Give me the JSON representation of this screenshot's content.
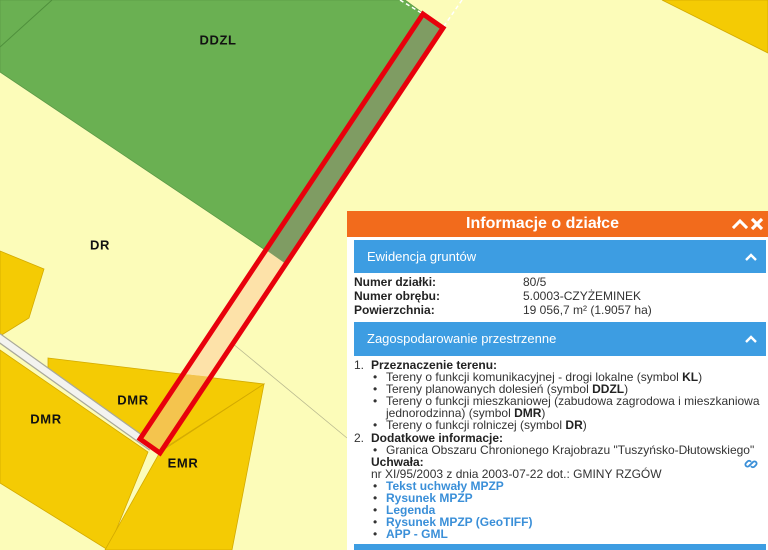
{
  "colors": {
    "header_bg": "#f26b1c",
    "section_bg": "#3d9de2",
    "link": "#3a8fd8",
    "parcel_outline": "#e8000b",
    "zone_forest": "#6ab052",
    "zone_residential": "#f4cb04",
    "zone_agricultural": "#fcfcb9"
  },
  "map": {
    "labels": [
      "DDZL",
      "DR",
      "DMR",
      "DMR",
      "EMR"
    ]
  },
  "panel": {
    "title": "Informacje o działce",
    "header_icons": [
      "chevron-up-icon",
      "close-icon"
    ],
    "land_registry": {
      "title": "Ewidencja gruntów",
      "icon": "chevron-up-icon",
      "rows": [
        {
          "label": "Numer działki:",
          "value": "80/5"
        },
        {
          "label": "Numer obrębu:",
          "value": "5.0003-CZYŻEMINEK"
        },
        {
          "label": "Powierzchnia:",
          "value": "19 056,7 m² (1.9057 ha)"
        }
      ]
    },
    "zoning": {
      "title": "Zagospodarowanie przestrzenne",
      "icon": "chevron-up-icon",
      "items": [
        {
          "number": "1.",
          "heading": "Przeznaczenie terenu:",
          "bullets": [
            {
              "text": "Tereny o funkcji komunikacyjnej - drogi lokalne (symbol",
              "symbol": "KL",
              "suffix": ")"
            },
            {
              "text": "Tereny planowanych dolesień (symbol",
              "symbol": "DDZL",
              "suffix": ")"
            },
            {
              "text": "Tereny o funkcji mieszkaniowej (zabudowa zagrodowa i mieszkaniowa jednorodzinna) (symbol",
              "symbol": "DMR",
              "suffix": ")"
            },
            {
              "text": "Tereny o funkcji rolniczej (symbol",
              "symbol": "DR",
              "suffix": ")"
            }
          ]
        },
        {
          "number": "2.",
          "heading": "Dodatkowe informacje:",
          "bullets": [
            {
              "text": "Granica Obszaru Chronionego Krajobrazu \"Tuszyńsko-Dłutowskiego\""
            }
          ],
          "resolution": {
            "label": "Uchwała:",
            "text": "nr XI/95/2003 z dnia 2003-07-22 dot.: GMINY RZGÓW",
            "icon": "chain-link-icon",
            "links": [
              "Tekst uchwały MPZP",
              "Rysunek MPZP",
              "Legenda",
              "Rysunek MPZP (GeoTIFF)",
              "APP - GML"
            ]
          }
        }
      ]
    }
  }
}
